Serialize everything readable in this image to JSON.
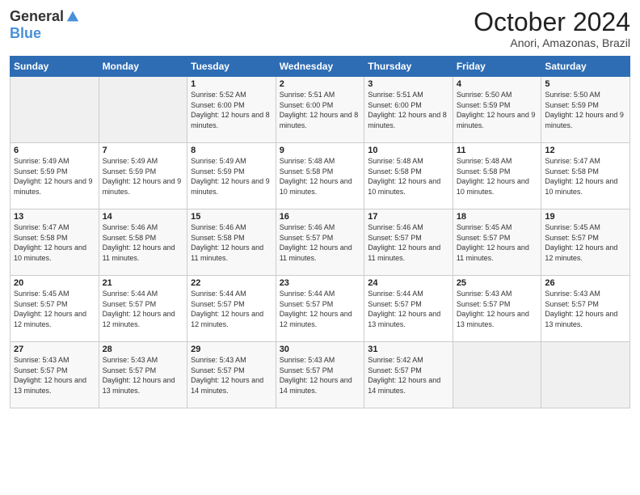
{
  "logo": {
    "general": "General",
    "blue": "Blue"
  },
  "title": "October 2024",
  "subtitle": "Anori, Amazonas, Brazil",
  "weekdays": [
    "Sunday",
    "Monday",
    "Tuesday",
    "Wednesday",
    "Thursday",
    "Friday",
    "Saturday"
  ],
  "weeks": [
    [
      {
        "day": "",
        "info": ""
      },
      {
        "day": "",
        "info": ""
      },
      {
        "day": "1",
        "info": "Sunrise: 5:52 AM\nSunset: 6:00 PM\nDaylight: 12 hours and 8 minutes."
      },
      {
        "day": "2",
        "info": "Sunrise: 5:51 AM\nSunset: 6:00 PM\nDaylight: 12 hours and 8 minutes."
      },
      {
        "day": "3",
        "info": "Sunrise: 5:51 AM\nSunset: 6:00 PM\nDaylight: 12 hours and 8 minutes."
      },
      {
        "day": "4",
        "info": "Sunrise: 5:50 AM\nSunset: 5:59 PM\nDaylight: 12 hours and 9 minutes."
      },
      {
        "day": "5",
        "info": "Sunrise: 5:50 AM\nSunset: 5:59 PM\nDaylight: 12 hours and 9 minutes."
      }
    ],
    [
      {
        "day": "6",
        "info": "Sunrise: 5:49 AM\nSunset: 5:59 PM\nDaylight: 12 hours and 9 minutes."
      },
      {
        "day": "7",
        "info": "Sunrise: 5:49 AM\nSunset: 5:59 PM\nDaylight: 12 hours and 9 minutes."
      },
      {
        "day": "8",
        "info": "Sunrise: 5:49 AM\nSunset: 5:59 PM\nDaylight: 12 hours and 9 minutes."
      },
      {
        "day": "9",
        "info": "Sunrise: 5:48 AM\nSunset: 5:58 PM\nDaylight: 12 hours and 10 minutes."
      },
      {
        "day": "10",
        "info": "Sunrise: 5:48 AM\nSunset: 5:58 PM\nDaylight: 12 hours and 10 minutes."
      },
      {
        "day": "11",
        "info": "Sunrise: 5:48 AM\nSunset: 5:58 PM\nDaylight: 12 hours and 10 minutes."
      },
      {
        "day": "12",
        "info": "Sunrise: 5:47 AM\nSunset: 5:58 PM\nDaylight: 12 hours and 10 minutes."
      }
    ],
    [
      {
        "day": "13",
        "info": "Sunrise: 5:47 AM\nSunset: 5:58 PM\nDaylight: 12 hours and 10 minutes."
      },
      {
        "day": "14",
        "info": "Sunrise: 5:46 AM\nSunset: 5:58 PM\nDaylight: 12 hours and 11 minutes."
      },
      {
        "day": "15",
        "info": "Sunrise: 5:46 AM\nSunset: 5:58 PM\nDaylight: 12 hours and 11 minutes."
      },
      {
        "day": "16",
        "info": "Sunrise: 5:46 AM\nSunset: 5:57 PM\nDaylight: 12 hours and 11 minutes."
      },
      {
        "day": "17",
        "info": "Sunrise: 5:46 AM\nSunset: 5:57 PM\nDaylight: 12 hours and 11 minutes."
      },
      {
        "day": "18",
        "info": "Sunrise: 5:45 AM\nSunset: 5:57 PM\nDaylight: 12 hours and 11 minutes."
      },
      {
        "day": "19",
        "info": "Sunrise: 5:45 AM\nSunset: 5:57 PM\nDaylight: 12 hours and 12 minutes."
      }
    ],
    [
      {
        "day": "20",
        "info": "Sunrise: 5:45 AM\nSunset: 5:57 PM\nDaylight: 12 hours and 12 minutes."
      },
      {
        "day": "21",
        "info": "Sunrise: 5:44 AM\nSunset: 5:57 PM\nDaylight: 12 hours and 12 minutes."
      },
      {
        "day": "22",
        "info": "Sunrise: 5:44 AM\nSunset: 5:57 PM\nDaylight: 12 hours and 12 minutes."
      },
      {
        "day": "23",
        "info": "Sunrise: 5:44 AM\nSunset: 5:57 PM\nDaylight: 12 hours and 12 minutes."
      },
      {
        "day": "24",
        "info": "Sunrise: 5:44 AM\nSunset: 5:57 PM\nDaylight: 12 hours and 13 minutes."
      },
      {
        "day": "25",
        "info": "Sunrise: 5:43 AM\nSunset: 5:57 PM\nDaylight: 12 hours and 13 minutes."
      },
      {
        "day": "26",
        "info": "Sunrise: 5:43 AM\nSunset: 5:57 PM\nDaylight: 12 hours and 13 minutes."
      }
    ],
    [
      {
        "day": "27",
        "info": "Sunrise: 5:43 AM\nSunset: 5:57 PM\nDaylight: 12 hours and 13 minutes."
      },
      {
        "day": "28",
        "info": "Sunrise: 5:43 AM\nSunset: 5:57 PM\nDaylight: 12 hours and 13 minutes."
      },
      {
        "day": "29",
        "info": "Sunrise: 5:43 AM\nSunset: 5:57 PM\nDaylight: 12 hours and 14 minutes."
      },
      {
        "day": "30",
        "info": "Sunrise: 5:43 AM\nSunset: 5:57 PM\nDaylight: 12 hours and 14 minutes."
      },
      {
        "day": "31",
        "info": "Sunrise: 5:42 AM\nSunset: 5:57 PM\nDaylight: 12 hours and 14 minutes."
      },
      {
        "day": "",
        "info": ""
      },
      {
        "day": "",
        "info": ""
      }
    ]
  ]
}
